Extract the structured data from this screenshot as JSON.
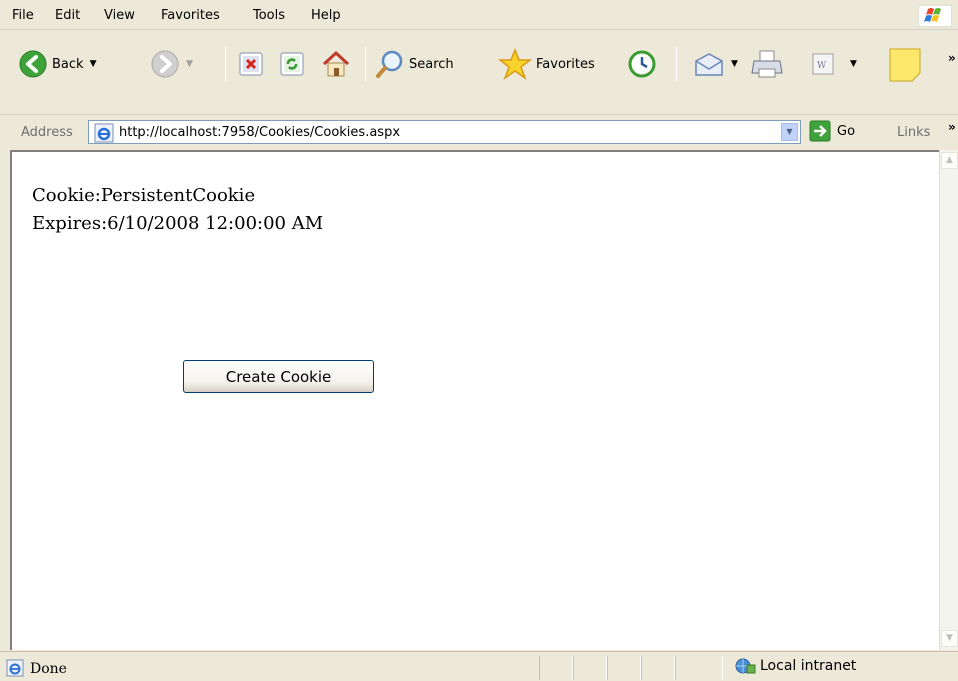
{
  "menu": [
    "File",
    "Edit",
    "View",
    "Favorites",
    "Tools",
    "Help"
  ],
  "toolbar": {
    "back_label": "Back",
    "search_label": "Search",
    "favorites_label": "Favorites"
  },
  "address": {
    "label": "Address",
    "url": "http://localhost:7958/Cookies/Cookies.aspx",
    "go_label": "Go",
    "links_label": "Links"
  },
  "page": {
    "cookie_line": "Cookie:PersistentCookie",
    "expires_line": "Expires:6/10/2008 12:00:00 AM",
    "button_label": "Create Cookie"
  },
  "status": {
    "text": "Done",
    "zone": "Local intranet"
  }
}
